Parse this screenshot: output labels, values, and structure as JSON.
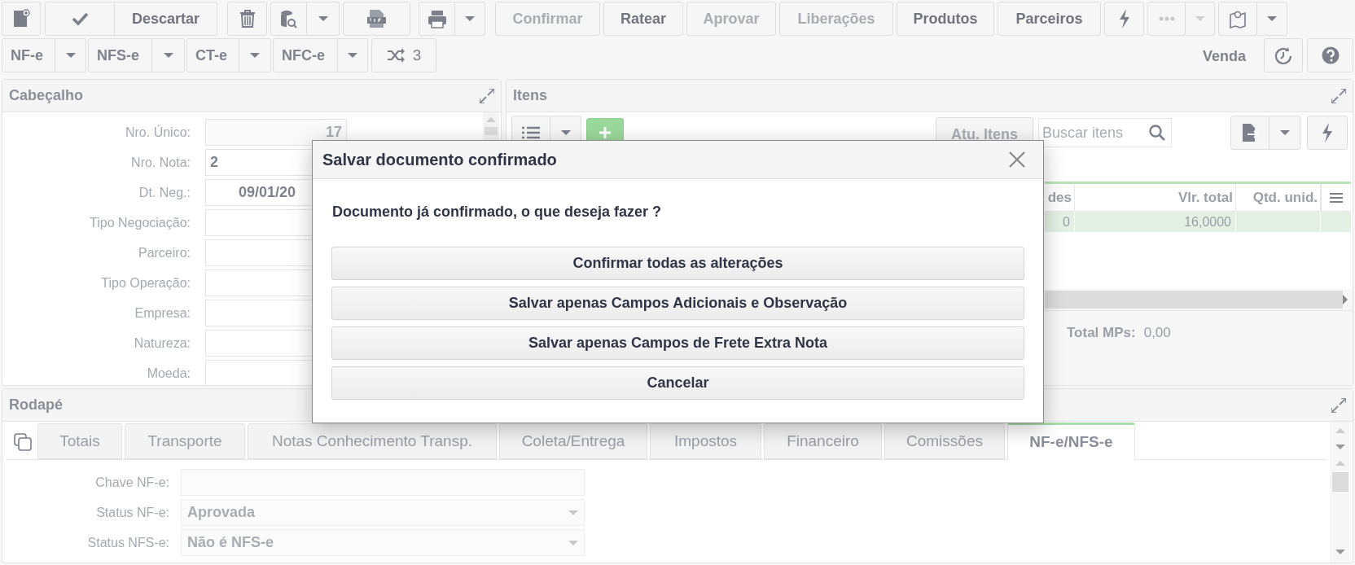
{
  "toolbar": {
    "buttons": [
      {
        "label": "Descartar",
        "disabled": false
      },
      {
        "label": "Confirmar",
        "disabled": true
      },
      {
        "label": "Ratear",
        "disabled": false
      },
      {
        "label": "Aprovar",
        "disabled": true
      },
      {
        "label": "Liberações",
        "disabled": true
      },
      {
        "label": "Produtos",
        "disabled": false
      },
      {
        "label": "Parceiros",
        "disabled": false
      }
    ],
    "doc_types": [
      "NF-e",
      "NFS-e",
      "CT-e",
      "NFC-e"
    ],
    "shuffle_count": "3",
    "mode": "Venda"
  },
  "header_panel": {
    "title": "Cabeçalho",
    "fields": [
      {
        "label": "Nro. Único:",
        "value": "17",
        "disabled": true
      },
      {
        "label": "Nro. Nota:",
        "value": "2",
        "disabled": false
      },
      {
        "label": "Dt. Neg.:",
        "value": "09/01/20",
        "disabled": false
      },
      {
        "label": "Tipo Negociação:"
      },
      {
        "label": "Parceiro:"
      },
      {
        "label": "Tipo Operação:"
      },
      {
        "label": "Empresa:"
      },
      {
        "label": "Natureza:"
      },
      {
        "label": "Moeda:"
      }
    ]
  },
  "items_panel": {
    "title": "Itens",
    "update_button": "Atu. Itens",
    "search": {
      "placeholder": "Buscar itens"
    },
    "table": {
      "columns": [
        "des",
        "Vlr. total",
        "Qtd. unid."
      ],
      "rows": [
        [
          "0",
          "16,0000",
          ""
        ]
      ]
    },
    "totals": [
      {
        "label": "Total MPs:",
        "value": "0,00"
      }
    ]
  },
  "footer_panel": {
    "title": "Rodapé",
    "tabs": [
      {
        "label": "Totais",
        "selected": false
      },
      {
        "label": "Transporte",
        "selected": false
      },
      {
        "label": "Notas Conhecimento Transp.",
        "selected": false
      },
      {
        "label": "Coleta/Entrega",
        "selected": false
      },
      {
        "label": "Impostos",
        "selected": false
      },
      {
        "label": "Financeiro",
        "selected": false
      },
      {
        "label": "Comissões",
        "selected": false
      },
      {
        "label": "NF-e/NFS-e",
        "selected": true
      }
    ],
    "fields": [
      {
        "label": "Chave NF-e:",
        "kind": "text"
      },
      {
        "label": "Status NF-e:",
        "value": "Aprovada",
        "kind": "select"
      },
      {
        "label": "Status NFS-e:",
        "value": "Não é NFS-e",
        "kind": "select"
      }
    ]
  },
  "dialog": {
    "title": "Salvar documento confirmado",
    "message": "Documento já confirmado, o que deseja fazer ?",
    "buttons": [
      "Confirmar todas as alterações",
      "Salvar apenas Campos Adicionais e Observação",
      "Salvar apenas Campos de Frete Extra Nota",
      "Cancelar"
    ]
  }
}
